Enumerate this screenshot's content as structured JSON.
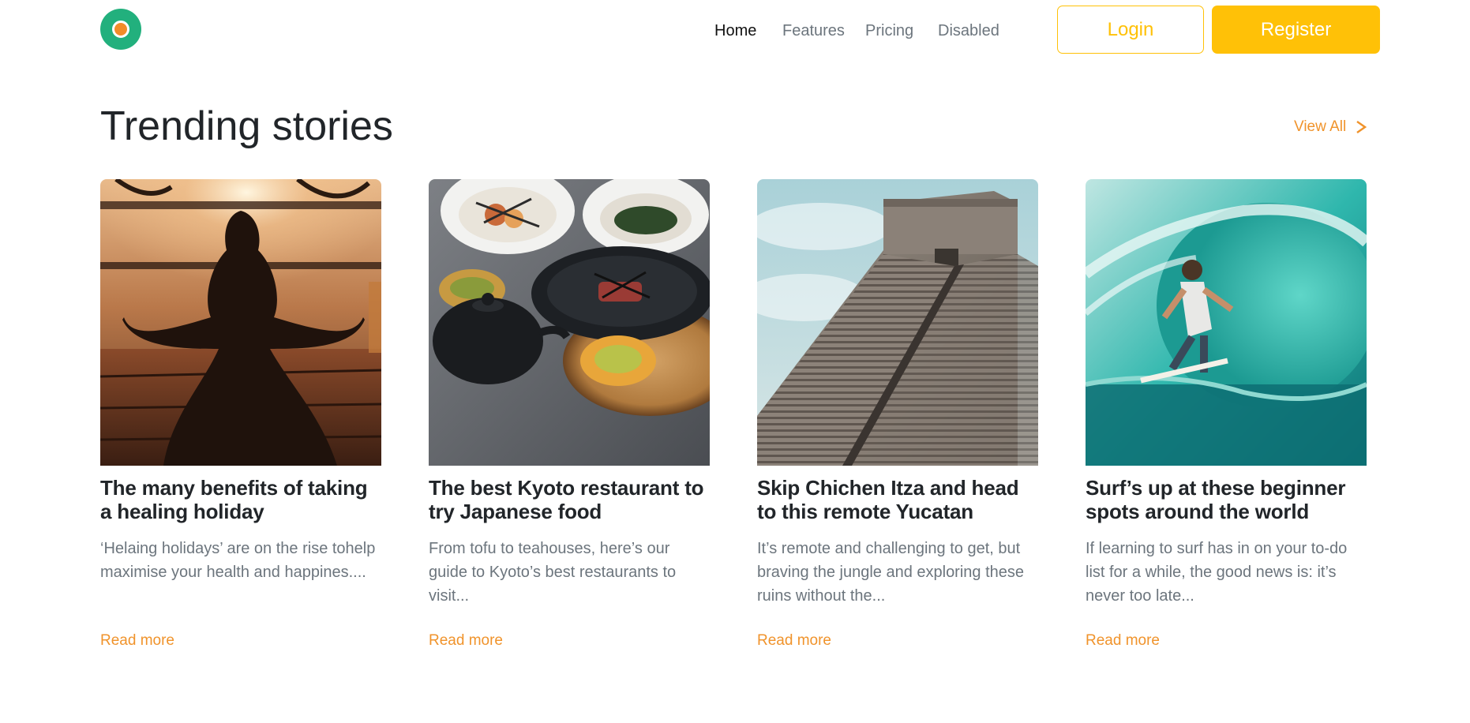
{
  "nav": {
    "items": [
      {
        "label": "Home",
        "active": true
      },
      {
        "label": "Features",
        "active": false
      },
      {
        "label": "Pricing",
        "active": false
      },
      {
        "label": "Disabled",
        "active": false
      }
    ],
    "login_label": "Login",
    "register_label": "Register"
  },
  "section": {
    "title": "Trending stories",
    "view_all": "View All"
  },
  "cards": [
    {
      "title": "The many benefits of taking a healing holiday",
      "excerpt": "‘Helaing holidays’ are on the rise tohelp maximise your health and happines....",
      "link": "Read more"
    },
    {
      "title": "The best Kyoto restaurant to try Japanese food",
      "excerpt": "From tofu to teahouses, here’s our guide to Kyoto’s best restaurants to visit...",
      "link": "Read more"
    },
    {
      "title": "Skip Chichen Itza and head to this remote Yucatan",
      "excerpt": "It’s remote and challenging to get, but braving the jungle and exploring these ruins without the...",
      "link": "Read more"
    },
    {
      "title": "Surf’s up at these beginner spots around the world",
      "excerpt": "If learning to surf has in on your to-do list for a while, the good news is: it’s never too late...",
      "link": "Read more"
    }
  ],
  "colors": {
    "accent": "#ffc107",
    "link": "#f0932b",
    "logo_outer": "#22b07d",
    "logo_inner": "#f28c28"
  }
}
